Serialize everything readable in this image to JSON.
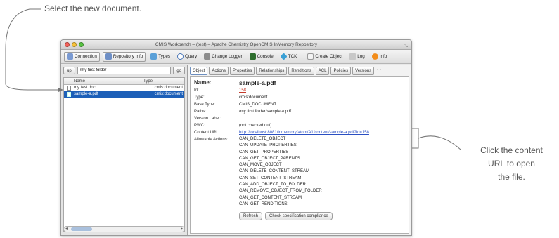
{
  "callouts": {
    "top": "Select the new document.",
    "right_line1": "Click the content",
    "right_line2": "URL to open",
    "right_line3": "the file."
  },
  "window": {
    "title": "CMIS Workbench – (test) – Apache Chemistry OpenCMIS InMemory Repository"
  },
  "toolbar": {
    "connection": "Connection",
    "repository_info": "Repository Info",
    "types": "Types",
    "query": "Query",
    "change_logger": "Change Logger",
    "console": "Console",
    "tck": "TCK",
    "create_object": "Create Object",
    "log": "Log",
    "info": "Info"
  },
  "left": {
    "up_label": "up",
    "path_value": "/my first folder",
    "go_label": "go",
    "col_name": "Name",
    "col_type": "Type",
    "rows": [
      {
        "name": "my test doc",
        "type": "cmis:document"
      },
      {
        "name": "sample-a.pdf",
        "type": "cmis:document"
      }
    ]
  },
  "tabs": [
    "Object",
    "Actions",
    "Properties",
    "Relationships",
    "Renditions",
    "ACL",
    "Policies",
    "Versions"
  ],
  "tab_more": "‹ ›",
  "details": {
    "name_label": "Name:",
    "name_value": "sample-a.pdf",
    "id_label": "Id:",
    "id_value": "158",
    "type_label": "Type:",
    "type_value": "cmis:document",
    "base_type_label": "Base Type:",
    "base_type_value": "CMIS_DOCUMENT",
    "paths_label": "Paths:",
    "paths_value": "/my first folder/sample-a.pdf",
    "version_label_label": "Version Label:",
    "version_label_value": "",
    "pwc_label": "PWC:",
    "pwc_value": "(not checked out)",
    "content_url_label": "Content URL:",
    "content_url_value": "http://localhost:8081/inmemory/atom/A1/content/sample-a.pdf?id=158",
    "allowable_label": "Allowable Actions:",
    "allowable_actions": [
      "CAN_DELETE_OBJECT",
      "CAN_UPDATE_PROPERTIES",
      "CAN_GET_PROPERTIES",
      "CAN_GET_OBJECT_PARENTS",
      "CAN_MOVE_OBJECT",
      "CAN_DELETE_CONTENT_STREAM",
      "CAN_SET_CONTENT_STREAM",
      "CAN_ADD_OBJECT_TO_FOLDER",
      "CAN_REMOVE_OBJECT_FROM_FOLDER",
      "CAN_GET_CONTENT_STREAM",
      "CAN_GET_RENDITIONS"
    ],
    "refresh_label": "Refresh",
    "check_label": "Check specification compliance"
  }
}
